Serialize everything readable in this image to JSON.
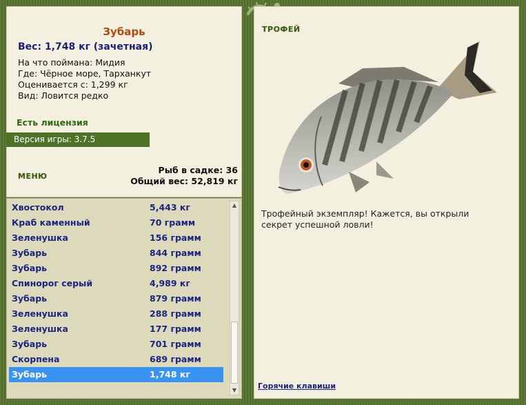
{
  "fish": {
    "name": "Зубарь",
    "weight_line": "Вес: 1,748 кг (зачетная)",
    "bait": "На что поймана: Мидия",
    "place": "Где: Чёрное море, Тарханкут",
    "value": "Оценивается с: 1,299 кг",
    "kind": "Вид: Ловится редко"
  },
  "license": "Есть лицензия",
  "version": "Версия игры: 3.7.5",
  "menu_label": "МЕНЮ",
  "stats": {
    "count": "Рыб в садке: 36",
    "total": "Общий вес: 52,819 кг"
  },
  "catch_list": [
    {
      "name": "Хвостокол",
      "weight": "5,443 кг"
    },
    {
      "name": "Краб каменный",
      "weight": "70 грамм"
    },
    {
      "name": "Зеленушка",
      "weight": "156 грамм"
    },
    {
      "name": "Зубарь",
      "weight": "844 грамм"
    },
    {
      "name": "Зубарь",
      "weight": "892 грамм"
    },
    {
      "name": "Спинорог серый",
      "weight": "4,989 кг"
    },
    {
      "name": "Зубарь",
      "weight": "879 грамм"
    },
    {
      "name": "Зеленушка",
      "weight": "288 грамм"
    },
    {
      "name": "Зеленушка",
      "weight": "177 грамм"
    },
    {
      "name": "Зубарь",
      "weight": "701 грамм"
    },
    {
      "name": "Скорпена",
      "weight": "689 грамм"
    },
    {
      "name": "Зубарь",
      "weight": "1,748 кг"
    }
  ],
  "selected_index": 11,
  "trophy": {
    "title": "ТРОФЕЙ",
    "text": "Трофейный экземпляр! Кажется, вы открыли секрет успешной ловли!"
  },
  "hotkeys_label": "Горячие клавиши",
  "colors": {
    "frame": "#56722f",
    "panel": "#f3f0df",
    "fish_name": "#b4460f",
    "list_text": "#1a2583",
    "selection": "#3a93f2"
  }
}
